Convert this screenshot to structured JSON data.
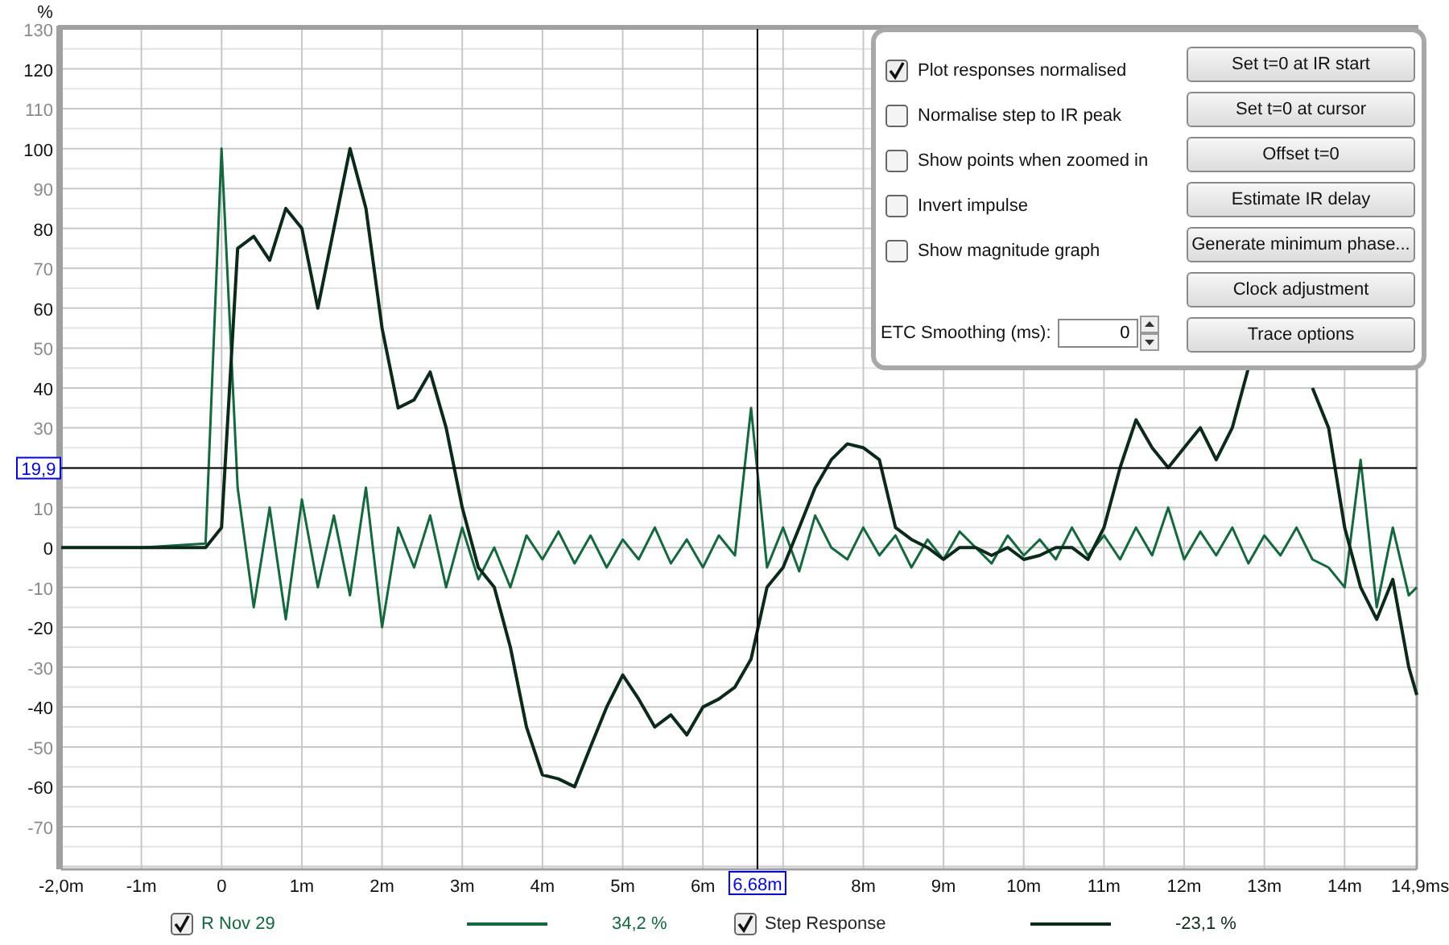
{
  "chart": {
    "chart_data": {
      "type": "line",
      "ylabel": "%",
      "xlim": [
        -2,
        14.9
      ],
      "ylim": [
        -80.7,
        130
      ],
      "xticks": [
        {
          "value": -2,
          "label": "-2,0m"
        },
        {
          "value": -1,
          "label": "-1m"
        },
        {
          "value": 0,
          "label": "0"
        },
        {
          "value": 1,
          "label": "1m"
        },
        {
          "value": 2,
          "label": "2m"
        },
        {
          "value": 3,
          "label": "3m"
        },
        {
          "value": 4,
          "label": "4m"
        },
        {
          "value": 5,
          "label": "5m"
        },
        {
          "value": 6,
          "label": "6m"
        },
        {
          "value": 8,
          "label": "8m"
        },
        {
          "value": 9,
          "label": "9m"
        },
        {
          "value": 10,
          "label": "10m"
        },
        {
          "value": 11,
          "label": "11m"
        },
        {
          "value": 12,
          "label": "12m"
        },
        {
          "value": 13,
          "label": "13m"
        },
        {
          "value": 14,
          "label": "14m"
        },
        {
          "value": 14.9,
          "label": "14,9ms"
        }
      ],
      "yticks": [
        -70,
        -60,
        -50,
        -40,
        -30,
        -20,
        -10,
        0,
        10,
        30,
        40,
        50,
        60,
        70,
        80,
        90,
        100,
        110,
        120,
        130
      ],
      "x": [
        -2,
        -1,
        -0.2,
        0,
        0.2,
        0.4,
        0.6,
        0.8,
        1,
        1.2,
        1.4,
        1.6,
        1.8,
        2,
        2.2,
        2.4,
        2.6,
        2.8,
        3,
        3.2,
        3.4,
        3.6,
        3.8,
        4,
        4.2,
        4.4,
        4.6,
        4.8,
        5,
        5.2,
        5.4,
        5.6,
        5.8,
        6,
        6.2,
        6.4,
        6.6,
        6.8,
        7,
        7.2,
        7.4,
        7.6,
        7.8,
        8,
        8.2,
        8.4,
        8.6,
        8.8,
        9,
        9.2,
        9.4,
        9.6,
        9.8,
        10,
        10.2,
        10.4,
        10.6,
        10.8,
        11,
        11.2,
        11.4,
        11.6,
        11.8,
        12,
        12.2,
        12.4,
        12.6,
        12.8,
        13,
        13.2,
        13.4,
        13.6,
        13.8,
        14,
        14.2,
        14.4,
        14.6,
        14.8,
        14.9
      ],
      "series": [
        {
          "name": "R Nov 29",
          "color": "#106a3c",
          "values": [
            0,
            0,
            1,
            100,
            15,
            -15,
            10,
            -18,
            12,
            -10,
            8,
            -12,
            15,
            -20,
            5,
            -5,
            8,
            -10,
            5,
            -8,
            0,
            -10,
            3,
            -3,
            4,
            -4,
            3,
            -5,
            2,
            -3,
            5,
            -4,
            2,
            -5,
            3,
            -2,
            35,
            -5,
            5,
            -6,
            8,
            0,
            -3,
            5,
            -2,
            3,
            -5,
            2,
            -3,
            4,
            0,
            -4,
            3,
            -2,
            2,
            -3,
            5,
            -2,
            3,
            -3,
            5,
            -2,
            10,
            -3,
            4,
            -2,
            5,
            -4,
            3,
            -2,
            5,
            -3,
            -5,
            -10,
            22,
            -15,
            5,
            -12,
            -10
          ]
        },
        {
          "name": "Step Response",
          "color": "#0a2a1a",
          "values": [
            0,
            0,
            0,
            5,
            75,
            78,
            72,
            85,
            80,
            60,
            80,
            100,
            85,
            55,
            35,
            37,
            44,
            30,
            10,
            -5,
            -10,
            -25,
            -45,
            -57,
            -58,
            -60,
            -50,
            -40,
            -32,
            -38,
            -45,
            -42,
            -47,
            -40,
            -38,
            -35,
            -28,
            -10,
            -5,
            5,
            15,
            22,
            26,
            25,
            22,
            5,
            2,
            0,
            -3,
            0,
            0,
            -2,
            0,
            -3,
            -2,
            0,
            0,
            -3,
            5,
            20,
            32,
            25,
            20,
            25,
            30,
            22,
            30,
            45,
            null,
            null,
            null,
            40,
            30,
            5,
            -10,
            -18,
            -8,
            -30,
            -37
          ]
        }
      ],
      "grid": true,
      "ref_lines": [
        {
          "axis": "y",
          "value": 19.9,
          "label": "19,9"
        },
        {
          "axis": "x",
          "value": 6.68,
          "label": "6,68m"
        }
      ]
    }
  },
  "options_panel": {
    "checkboxes": [
      {
        "label": "Plot responses normalised",
        "checked": true
      },
      {
        "label": "Normalise step to IR peak",
        "checked": false
      },
      {
        "label": "Show points when zoomed in",
        "checked": false
      },
      {
        "label": "Invert impulse",
        "checked": false
      },
      {
        "label": "Show magnitude graph",
        "checked": false
      }
    ],
    "smoothing": {
      "label": "ETC Smoothing (ms):",
      "value": "0"
    },
    "buttons": [
      "Set t=0 at IR start",
      "Set t=0 at cursor",
      "Offset t=0",
      "Estimate IR delay",
      "Generate minimum phase...",
      "Clock adjustment",
      "Trace options"
    ]
  },
  "legend": [
    {
      "checked": true,
      "reading": "34,2 %"
    },
    {
      "checked": true,
      "reading": "-23,1 %"
    }
  ]
}
